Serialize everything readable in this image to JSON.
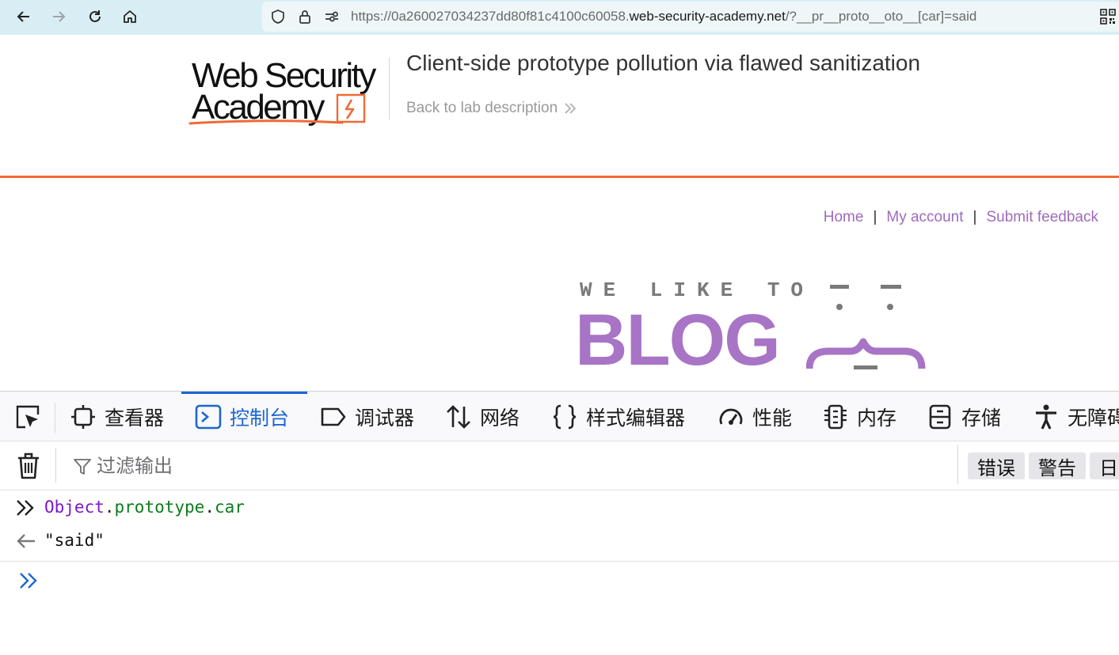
{
  "browser": {
    "url_prefix": "https://0a260027034237dd80f81c4100c60058.",
    "url_host": "web-security-academy.net",
    "url_path": "/?__pr__proto__oto__[car]=said",
    "icons": [
      "back-arrow-icon",
      "forward-arrow-icon",
      "reload-icon",
      "home-icon",
      "shield-icon",
      "lock-icon",
      "permissions-icon",
      "qr-code-icon"
    ]
  },
  "header": {
    "logo_line1": "Web Security",
    "logo_line2": "Academy",
    "lab_title": "Client-side prototype pollution via flawed sanitization",
    "back_link": "Back to lab description",
    "accent_color": "#f06a35"
  },
  "nav": {
    "items": [
      {
        "label": "Home"
      },
      {
        "label": "My account"
      },
      {
        "label": "Submit feedback"
      }
    ],
    "separator": "|",
    "link_color": "#9e6bbd"
  },
  "banner": {
    "tagline": "WE LIKE TO",
    "title": "BLOG",
    "title_color": "#a874c6"
  },
  "devtools": {
    "tabs": [
      {
        "label": "查看器",
        "icon": "inspector-icon"
      },
      {
        "label": "控制台",
        "icon": "console-icon",
        "active": true
      },
      {
        "label": "调试器",
        "icon": "debugger-icon"
      },
      {
        "label": "网络",
        "icon": "network-icon"
      },
      {
        "label": "样式编辑器",
        "icon": "style-editor-icon"
      },
      {
        "label": "性能",
        "icon": "performance-icon"
      },
      {
        "label": "内存",
        "icon": "memory-icon"
      },
      {
        "label": "存储",
        "icon": "storage-icon"
      },
      {
        "label": "无障碍",
        "icon": "accessibility-icon"
      }
    ],
    "active_color": "#1d66d2",
    "filter_placeholder": "过滤输出",
    "levels": [
      "错误",
      "警告",
      "日"
    ],
    "console": {
      "input_tokens": [
        "Object",
        ".",
        "prototype",
        ".",
        "car"
      ],
      "result": "\"said\""
    }
  }
}
